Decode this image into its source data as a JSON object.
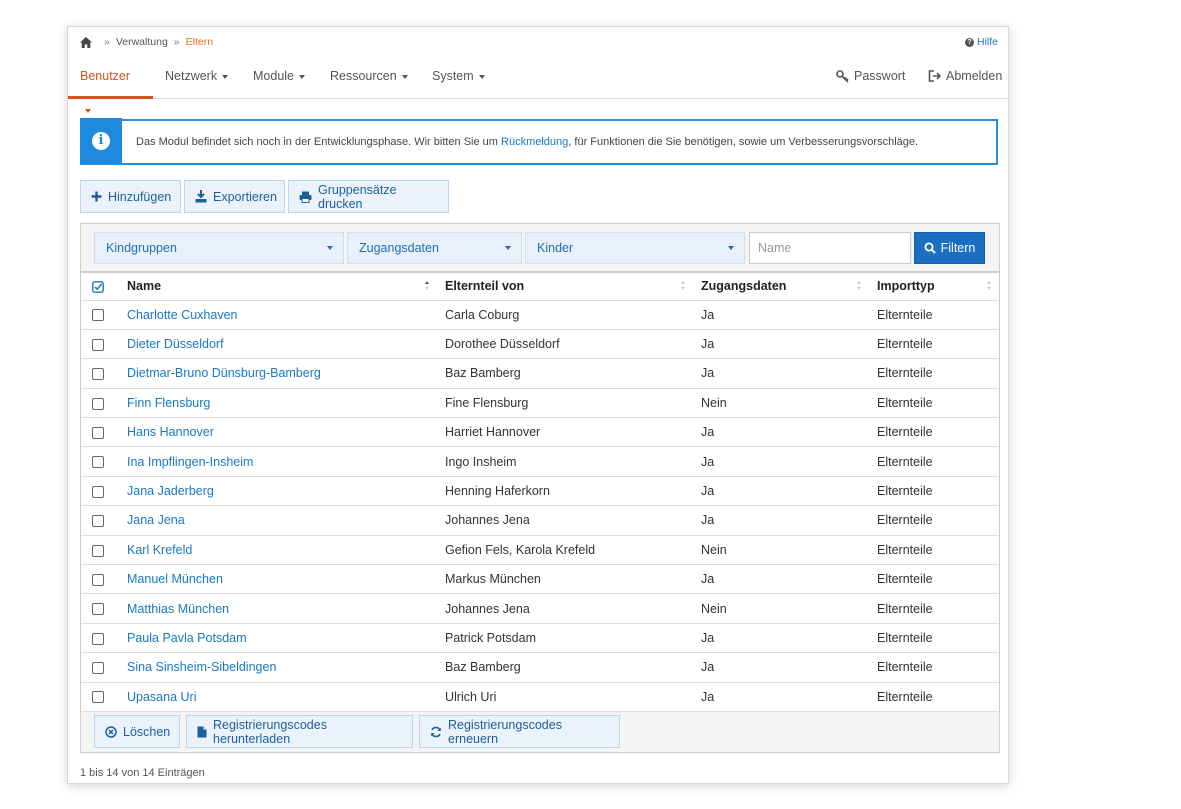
{
  "breadcrumb": {
    "items": [
      "Verwaltung",
      "Eltern"
    ],
    "separator": "»"
  },
  "help_label": "Hilfe",
  "nav": {
    "items": [
      "Benutzer",
      "Netzwerk",
      "Module",
      "Ressourcen",
      "System"
    ],
    "active": "Benutzer",
    "password_label": "Passwort",
    "logout_label": "Abmelden"
  },
  "info": {
    "text_before": "Das Modul befindet sich noch in der Entwicklungsphase. Wir bitten Sie um ",
    "link": "Rückmeldung",
    "text_after": ", für Funktionen die Sie benötigen, sowie um Verbesserungsvorschläge."
  },
  "toolbar": {
    "add_label": "Hinzufügen",
    "export_label": "Exportieren",
    "print_label": "Gruppensätze drucken"
  },
  "filters": {
    "kindgruppen": "Kindgruppen",
    "zugangsdaten": "Zugangsdaten",
    "kinder": "Kinder",
    "name_placeholder": "Name",
    "filter_label": "Filtern"
  },
  "table": {
    "headers": [
      "Name",
      "Elternteil von",
      "Zugangsdaten",
      "Importtyp"
    ],
    "rows": [
      [
        "Charlotte Cuxhaven",
        "Carla Coburg",
        "Ja",
        "Elternteile"
      ],
      [
        "Dieter Düsseldorf",
        "Dorothee Düsseldorf",
        "Ja",
        "Elternteile"
      ],
      [
        "Dietmar-Bruno Dünsburg-Bamberg",
        "Baz Bamberg",
        "Ja",
        "Elternteile"
      ],
      [
        "Finn Flensburg",
        "Fine Flensburg",
        "Nein",
        "Elternteile"
      ],
      [
        "Hans Hannover",
        "Harriet Hannover",
        "Ja",
        "Elternteile"
      ],
      [
        "Ina Impflingen-Insheim",
        "Ingo Insheim",
        "Ja",
        "Elternteile"
      ],
      [
        "Jana Jaderberg",
        "Henning Haferkorn",
        "Ja",
        "Elternteile"
      ],
      [
        "Jana Jena",
        "Johannes Jena",
        "Ja",
        "Elternteile"
      ],
      [
        "Karl Krefeld",
        "Gefion Fels, Karola Krefeld",
        "Nein",
        "Elternteile"
      ],
      [
        "Manuel München",
        "Markus München",
        "Ja",
        "Elternteile"
      ],
      [
        "Matthias München",
        "Johannes Jena",
        "Nein",
        "Elternteile"
      ],
      [
        "Paula Pavla Potsdam",
        "Patrick Potsdam",
        "Ja",
        "Elternteile"
      ],
      [
        "Sina Sinsheim-Sibeldingen",
        "Baz Bamberg",
        "Ja",
        "Elternteile"
      ],
      [
        "Upasana Uri",
        "Ulrich Uri",
        "Ja",
        "Elternteile"
      ]
    ]
  },
  "bulk": {
    "delete_label": "Löschen",
    "download_label": "Registrierungscodes herunterladen",
    "renew_label": "Registrierungscodes erneuern"
  },
  "pagination_text": "1 bis 14 von 14 Einträgen",
  "colors": {
    "accent": "#d9531e",
    "primary": "#1b6fc1",
    "link": "#1a78c2"
  }
}
